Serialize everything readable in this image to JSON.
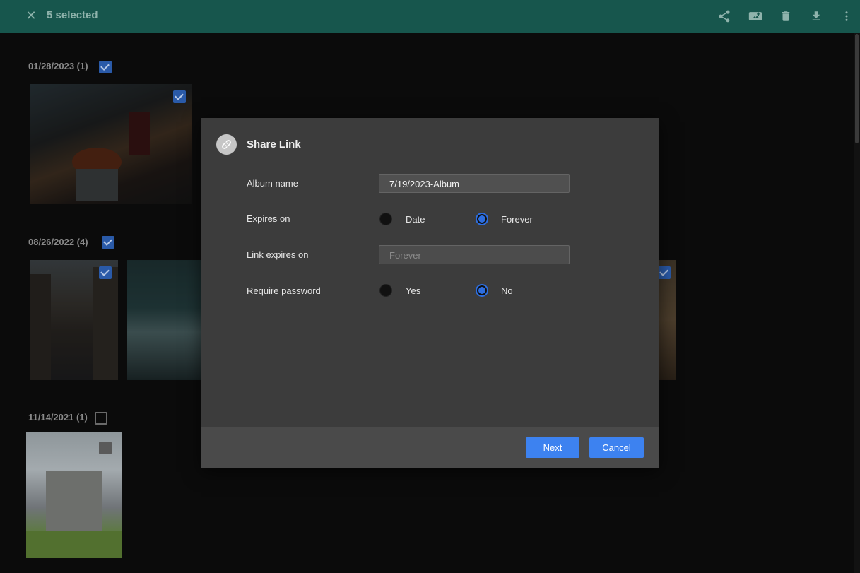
{
  "topbar": {
    "selected_text": "5 selected",
    "close_icon": "close-icon",
    "tools": [
      "share-icon",
      "add-to-album-icon",
      "trash-icon",
      "download-icon",
      "more-vertical-icon"
    ]
  },
  "gallery": {
    "groups": [
      {
        "heading": "01/28/2023 (1)",
        "checked": true
      },
      {
        "heading": "08/26/2022 (4)",
        "checked": true
      },
      {
        "heading": "11/14/2021 (1)",
        "checked": false
      }
    ]
  },
  "dialog": {
    "title": "Share Link",
    "icon": "link-icon",
    "album_name": {
      "label": "Album name",
      "value": "7/19/2023-Album"
    },
    "expires_on": {
      "label": "Expires on",
      "options": [
        "Date",
        "Forever"
      ],
      "selected": "Forever"
    },
    "link_expires_on": {
      "label": "Link expires on",
      "placeholder": "Forever"
    },
    "require_password": {
      "label": "Require password",
      "options": [
        "Yes",
        "No"
      ],
      "selected": "No"
    },
    "next_label": "Next",
    "cancel_label": "Cancel"
  },
  "colors": {
    "topbar": "#17564d",
    "accent": "#3d82f0",
    "dialog_bg": "#3c3c3c"
  }
}
